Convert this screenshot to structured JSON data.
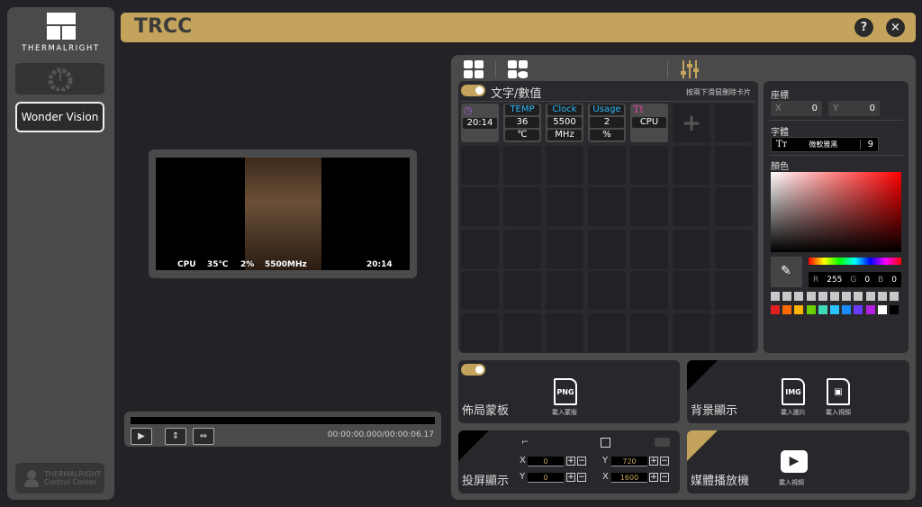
{
  "sidebar": {
    "brand": "THERMALRIGHT",
    "device": "Wonder Vision",
    "footer_line1": "THERMALRIGHT",
    "footer_line2": "Control Center"
  },
  "titlebar": {
    "title": "TRCC",
    "help": "?",
    "close": "×"
  },
  "preview": {
    "overlay": {
      "cpu": "CPU",
      "temp": "35℃",
      "usage": "2%",
      "clock": "5500MHz",
      "time": "20:14"
    }
  },
  "player": {
    "play": "▶",
    "time": "00:00:00.000/00:00:06.17"
  },
  "cards": {
    "title": "文字/數值",
    "hint": "按兩下滑鼠刪除卡片",
    "items": [
      {
        "type": "time",
        "value": "20:14"
      },
      {
        "label": "TEMP",
        "value": "36",
        "unit": "℃"
      },
      {
        "label": "Clock",
        "value": "5500",
        "unit": "MHz"
      },
      {
        "label": "Usage",
        "value": "2",
        "unit": "%"
      },
      {
        "type": "text",
        "icon": "Tt",
        "value": "CPU"
      }
    ],
    "add": "+"
  },
  "props": {
    "coord_label": "座標",
    "x_label": "X",
    "x": "0",
    "y_label": "Y",
    "y": "0",
    "font_label": "字體",
    "font_icon": "Tт",
    "font_name": "微軟雅黑",
    "font_size": "9",
    "color_label": "顏色",
    "r_label": "R",
    "r": "255",
    "g_label": "G",
    "g": "0",
    "b_label": "B",
    "b": "0",
    "swatches": [
      "#e02020",
      "#ff6a00",
      "#ffb400",
      "#6ccf00",
      "#3fd9b8",
      "#29c4ff",
      "#1a8cff",
      "#6a3cff",
      "#b21fe0",
      "#ffffff",
      "#000000"
    ],
    "custom_swatch": "#c8c8c8"
  },
  "mask": {
    "title": "佈局蒙板",
    "png": "PNG",
    "load": "載入蒙版"
  },
  "background": {
    "title": "背景顯示",
    "img": "IMG",
    "load_image": "載入圖片",
    "load_video": "載入視頻"
  },
  "cast": {
    "title": "投屏顯示",
    "x_label": "X",
    "x": "0",
    "y_label": "Y",
    "y": "0",
    "h_label": "Y",
    "h": "720",
    "w_label": "X",
    "w": "1600",
    "plus": "+",
    "minus": "−"
  },
  "media": {
    "title": "媒體播放機",
    "load_video": "載入視頻"
  },
  "colors": {
    "accent": "#c4a45c"
  }
}
